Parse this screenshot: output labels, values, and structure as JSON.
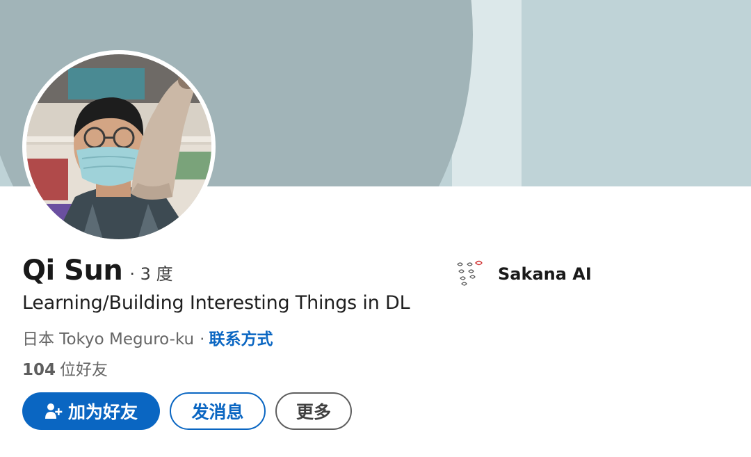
{
  "profile": {
    "name": "Qi Sun",
    "degree": "· 3 度",
    "headline": "Learning/Building Interesting Things in DL",
    "location": "日本 Tokyo Meguro-ku",
    "separator": "·",
    "contact_info_label": "联系方式",
    "connections_count": "104",
    "connections_label": "位好友"
  },
  "actions": {
    "connect_label": "加为好友",
    "message_label": "发消息",
    "more_label": "更多"
  },
  "company": {
    "name": "Sakana AI"
  },
  "colors": {
    "accent": "#0a66c2",
    "banner_dark": "#a1b4b8",
    "banner_light": "#bfd3d7",
    "banner_strip": "#dce8ea",
    "text_secondary": "#666666"
  },
  "icons": {
    "connect": "person-add-icon",
    "company": "sakana-fish-logo"
  }
}
